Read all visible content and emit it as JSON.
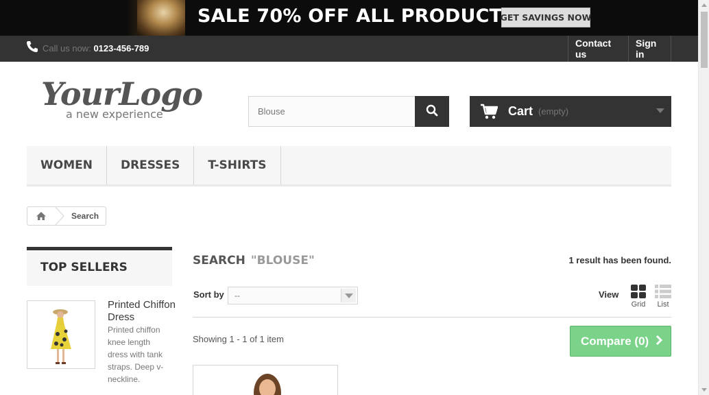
{
  "banner": {
    "headline": "SALE 70% OFF ALL PRODUCTS",
    "cta_label": "GET SAVINGS NOW"
  },
  "topbar": {
    "call_label": "Call us now:",
    "phone": "0123-456-789",
    "contact_label": "Contact us",
    "signin_label": "Sign in"
  },
  "logo": {
    "name": "YourLogo",
    "tagline": "a new experience"
  },
  "search": {
    "value": "Blouse",
    "icon": "search-icon"
  },
  "cart": {
    "label": "Cart",
    "status": "(empty)"
  },
  "menu": {
    "items": [
      "WOMEN",
      "DRESSES",
      "T-SHIRTS"
    ]
  },
  "breadcrumb": {
    "current": "Search"
  },
  "sidebar": {
    "title": "TOP SELLERS",
    "product": {
      "name": "Printed Chiffon Dress",
      "description": "Printed chiffon knee length dress with tank straps. Deep v-neckline."
    }
  },
  "main": {
    "heading": "SEARCH",
    "query": "\"BLOUSE\"",
    "results_text": "1 result has been found.",
    "sort_label": "Sort by",
    "sort_value": "--",
    "view_label": "View",
    "grid_label": "Grid",
    "list_label": "List",
    "showing_text": "Showing 1 - 1 of 1 item",
    "compare_label": "Compare (0)"
  },
  "colors": {
    "dark": "#333333",
    "compare_green": "#7bd38a",
    "menu_bg": "#f6f6f6"
  }
}
